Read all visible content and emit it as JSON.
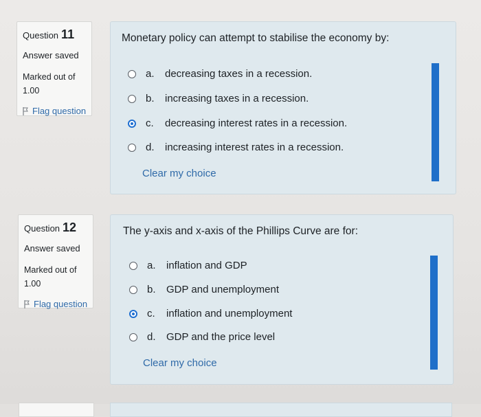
{
  "questions": [
    {
      "label": "Question",
      "number": "11",
      "state": "Answer saved",
      "marked_label": "Marked out of",
      "marked_value": "1.00",
      "flag_label": "Flag question",
      "text": "Monetary policy can attempt to stabilise the economy by:",
      "options": [
        {
          "letter": "a.",
          "text": "decreasing taxes in a recession.",
          "checked": false
        },
        {
          "letter": "b.",
          "text": "increasing taxes in a recession.",
          "checked": false
        },
        {
          "letter": "c.",
          "text": "decreasing interest rates in a recession.",
          "checked": true
        },
        {
          "letter": "d.",
          "text": "increasing interest rates in a recession.",
          "checked": false
        }
      ],
      "clear_label": "Clear my choice"
    },
    {
      "label": "Question",
      "number": "12",
      "state": "Answer saved",
      "marked_label": "Marked out of",
      "marked_value": "1.00",
      "flag_label": "Flag question",
      "text": "The y-axis and x-axis of the Phillips Curve are for:",
      "options": [
        {
          "letter": "a.",
          "text": "inflation and GDP",
          "checked": false
        },
        {
          "letter": "b.",
          "text": "GDP and unemployment",
          "checked": false
        },
        {
          "letter": "c.",
          "text": "inflation and unemployment",
          "checked": true
        },
        {
          "letter": "d.",
          "text": "GDP and the price level",
          "checked": false
        }
      ],
      "clear_label": "Clear my choice"
    }
  ],
  "colors": {
    "accent": "#1f6fd1",
    "link": "#2f6aa8",
    "content_bg": "#dfe9ee",
    "info_bg": "#f7f7f6"
  }
}
